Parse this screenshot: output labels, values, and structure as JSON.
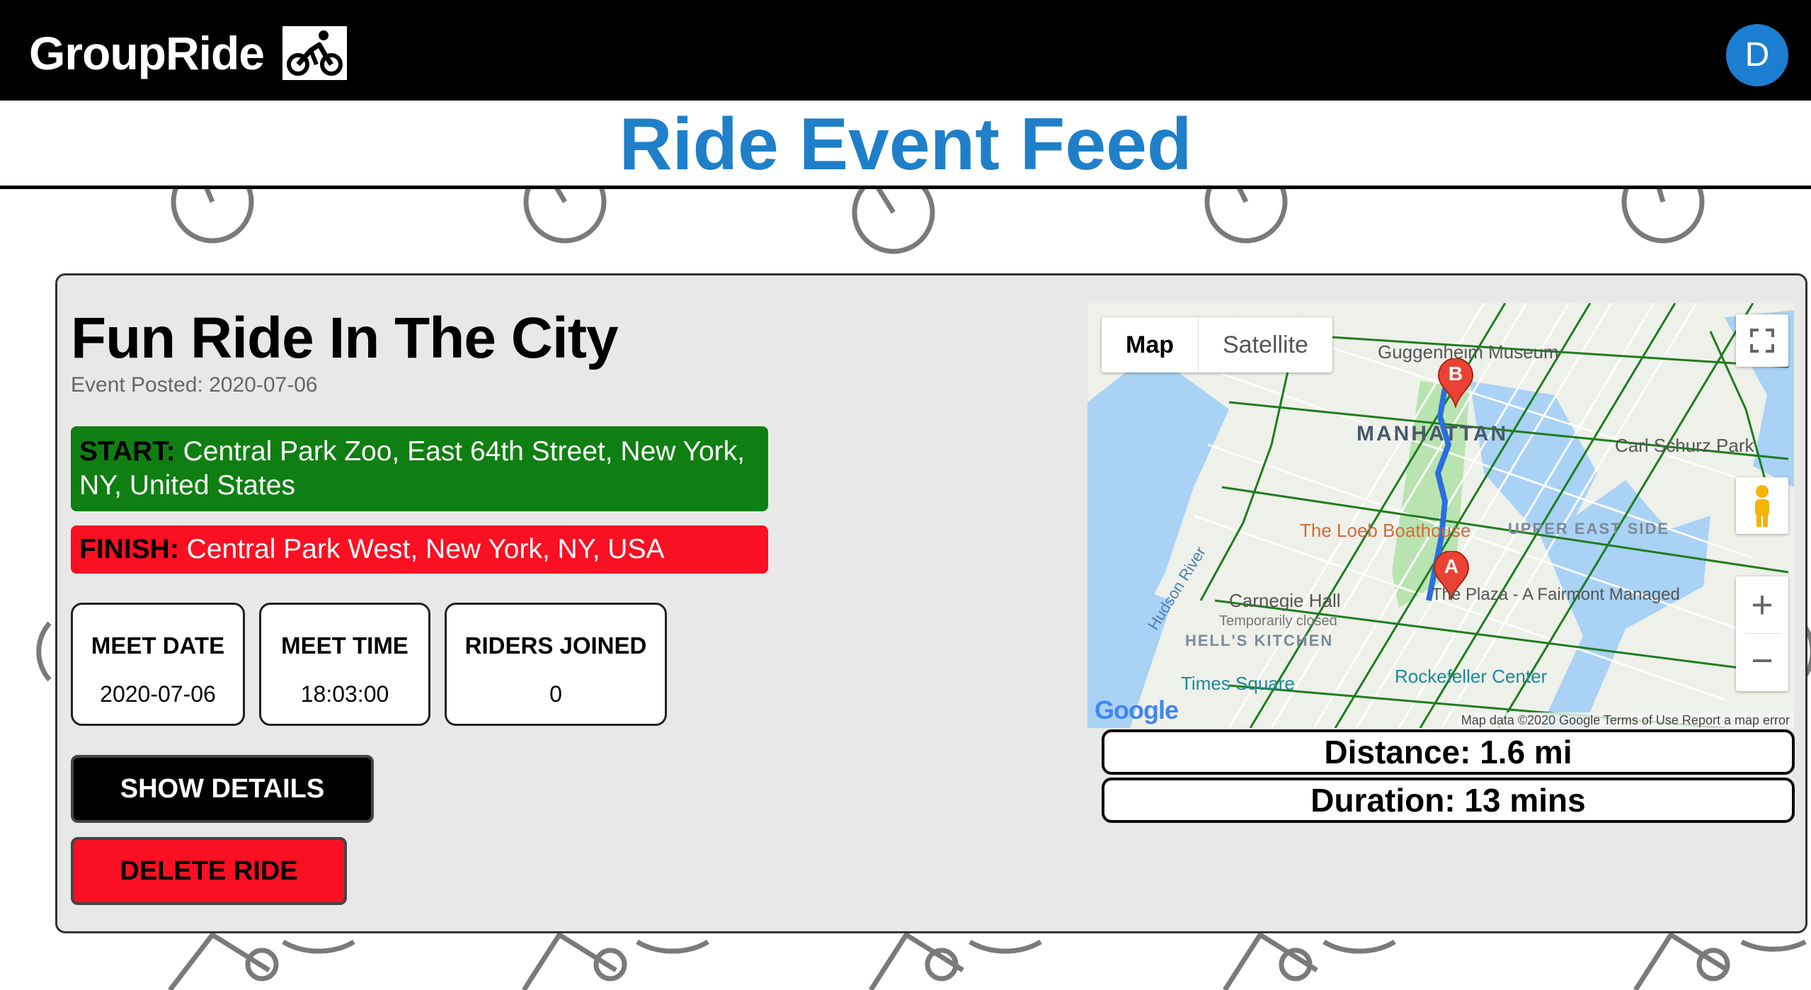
{
  "header": {
    "brand": "GroupRide",
    "brand_icon": "cyclist-icon",
    "avatar_initial": "D"
  },
  "page": {
    "title": "Ride Event Feed"
  },
  "ride": {
    "title": "Fun Ride In The City",
    "posted": "Event Posted: 2020-07-06",
    "start_label": "START:",
    "start_value": "Central Park Zoo, East 64th Street, New York, NY, United States",
    "finish_label": "FINISH:",
    "finish_value": "Central Park West, New York, NY, USA",
    "stats": [
      {
        "label": "MEET DATE",
        "value": "2020-07-06"
      },
      {
        "label": "MEET TIME",
        "value": "18:03:00"
      },
      {
        "label": "RIDERS JOINED",
        "value": "0"
      }
    ],
    "show_details": "SHOW DETAILS",
    "delete_ride": "DELETE RIDE",
    "distance": "Distance: 1.6 mi",
    "duration": "Duration: 13 mins"
  },
  "map": {
    "type_map": "Map",
    "type_satellite": "Satellite",
    "footer": "Map data ©2020 Google   Terms of Use   Report a map error",
    "logo": "Google",
    "marker_a": "A",
    "marker_b": "B",
    "labels": {
      "manhattan": "MANHATTAN",
      "loeb": "The Loeb Boathouse",
      "upper_east": "UPPER EAST SIDE",
      "carnegie": "Carnegie Hall",
      "hells_kitchen": "HELL'S KITCHEN",
      "times_square": "Times Square",
      "rockefeller": "Rockefeller Center",
      "plaza": "The Plaza - A Fairmont Managed",
      "guggenheim": "Guggenheim Museum",
      "carl_schurz": "Carl Schurz Park",
      "hudson": "Hudson River",
      "temp_closed": "Temporarily closed"
    },
    "colors": {
      "water": "#a9d2f5",
      "park": "#b9e3b0",
      "route": "#2a6fe0",
      "marker": "#ea4335"
    }
  }
}
